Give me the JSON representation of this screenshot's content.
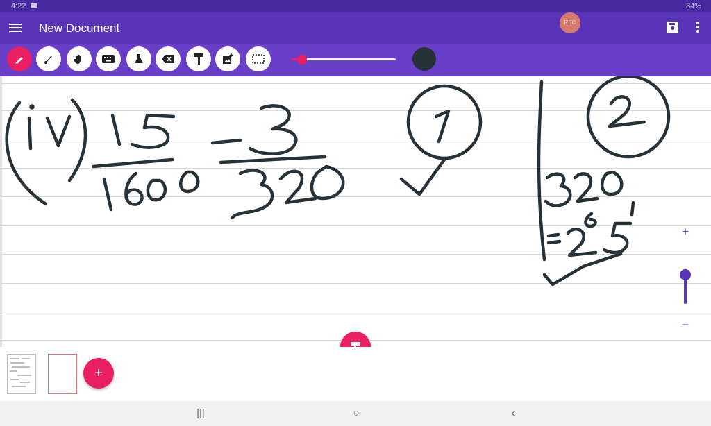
{
  "status_bar": {
    "time": "4:22",
    "battery": "84%"
  },
  "app_bar": {
    "title": "New Document",
    "record_label": "REC"
  },
  "toolbar": {
    "tools": [
      {
        "name": "pen-tool",
        "glyph": "✎",
        "active": true
      },
      {
        "name": "brush-tool",
        "glyph": "🖌",
        "active": false
      },
      {
        "name": "hand-tool",
        "glyph": "✋",
        "active": false
      },
      {
        "name": "keyboard-tool",
        "glyph": "⌨",
        "active": false
      },
      {
        "name": "flask-tool",
        "glyph": "⚗",
        "active": false
      },
      {
        "name": "eraser-tool",
        "glyph": "⌫",
        "active": false
      },
      {
        "name": "roller-tool",
        "glyph": "T",
        "active": false
      },
      {
        "name": "add-image-tool",
        "glyph": "🖼",
        "active": false
      },
      {
        "name": "select-tool",
        "glyph": "⬚",
        "active": false
      }
    ],
    "stroke_size_fraction": 0.05,
    "pen_color": "#263238",
    "accent_color": "#e91e63"
  },
  "canvas": {
    "handwriting": "(iv) 15/1600 − 3/320   (1) ✓   (2)  320 = 2⁶ 5¹ ✓"
  },
  "zoom": {
    "plus": "+",
    "minus": "−",
    "level_fraction": 0.6
  },
  "fab": {
    "label": "T"
  },
  "pages": {
    "add_label": "+",
    "count": 2
  },
  "navbar": {
    "recents": "|||",
    "home": "○",
    "back": "‹"
  }
}
